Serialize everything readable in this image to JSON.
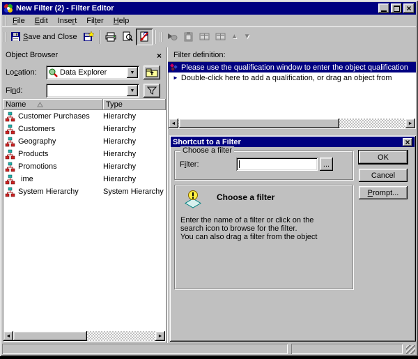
{
  "window": {
    "title": "New Filter (2) - Filter Editor"
  },
  "menu": {
    "items": [
      {
        "pre": "",
        "key": "F",
        "post": "ile"
      },
      {
        "pre": "",
        "key": "E",
        "post": "dit"
      },
      {
        "pre": "Inse",
        "key": "r",
        "post": "t"
      },
      {
        "pre": "Fil",
        "key": "t",
        "post": "er"
      },
      {
        "pre": "",
        "key": "H",
        "post": "elp"
      }
    ]
  },
  "toolbar": {
    "save_and_close": {
      "pre": "",
      "key": "S",
      "post": "ave and Close"
    }
  },
  "object_browser": {
    "title": "Object Browser",
    "location_label": {
      "pre": "Lo",
      "key": "c",
      "post": "ation:"
    },
    "location_value": "Data Explorer",
    "find_label": {
      "pre": "Fi",
      "key": "n",
      "post": "d:"
    },
    "find_value": "",
    "columns": {
      "name": "Name",
      "type": "Type"
    },
    "rows": [
      {
        "name": "Customer Purchases",
        "type": "Hierarchy"
      },
      {
        "name": "Customers",
        "type": "Hierarchy"
      },
      {
        "name": "Geography",
        "type": "Hierarchy"
      },
      {
        "name": "Products",
        "type": "Hierarchy"
      },
      {
        "name": "Promotions",
        "type": "Hierarchy"
      },
      {
        "name": "ime",
        "type": "Hierarchy"
      },
      {
        "name": "System Hierarchy",
        "type": "System Hierarchy"
      }
    ]
  },
  "filter_definition": {
    "label": "Filter definition:",
    "row1": "Please use the qualification window to enter the object qualification",
    "row2": "Double-click here to add a qualification, or drag an object from"
  },
  "dialog": {
    "title": "Shortcut to a Filter",
    "choose_group_label": "Choose a filter",
    "filter_label": {
      "pre": "F",
      "key": "i",
      "post": "lter:"
    },
    "filter_value": "",
    "browse_button": "...",
    "ok_button": "OK",
    "cancel_button": "Cancel",
    "prompt_button": {
      "pre": "",
      "key": "P",
      "post": "rompt..."
    },
    "info_title": "Choose a filter",
    "info_line1": "Enter the name of a filter or click on the",
    "info_line2": "search icon to browse for the filter.",
    "info_line3": "You can also drag a filter from the object"
  },
  "colors": {
    "titlebar": "#000080",
    "selection": "#000080",
    "chrome": "#c0c0c0"
  }
}
